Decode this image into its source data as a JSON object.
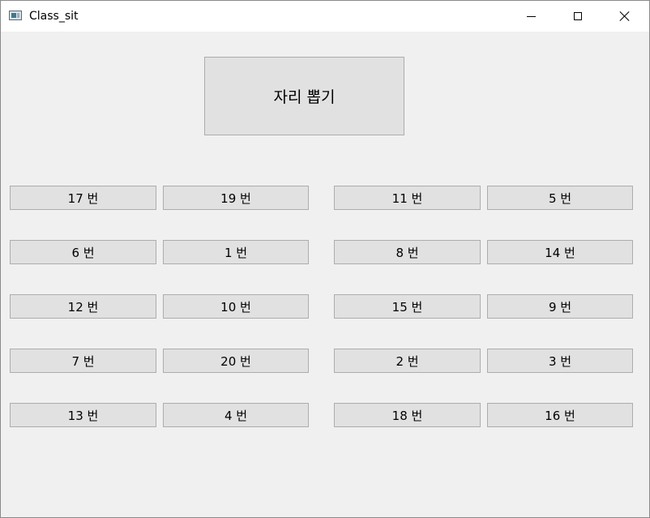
{
  "window": {
    "title": "Class_sit"
  },
  "draw_button_label": "자리 뽑기",
  "seats": [
    [
      "17 번",
      "19 번",
      "11 번",
      "5 번"
    ],
    [
      "6 번",
      "1 번",
      "8 번",
      "14 번"
    ],
    [
      "12 번",
      "10 번",
      "15 번",
      "9 번"
    ],
    [
      "7 번",
      "20 번",
      "2 번",
      "3 번"
    ],
    [
      "13 번",
      "4 번",
      "18 번",
      "16 번"
    ]
  ]
}
